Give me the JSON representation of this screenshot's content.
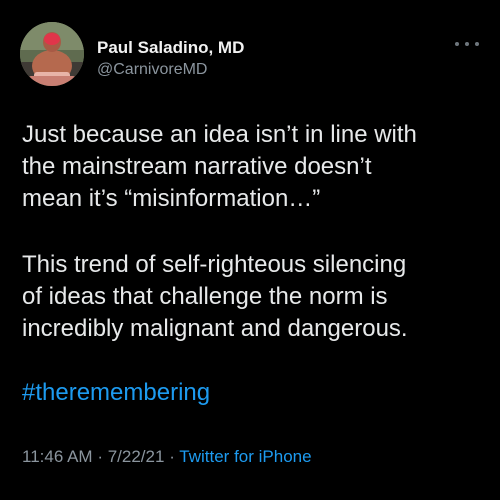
{
  "tweet": {
    "author_name": "Paul Saladino, MD",
    "author_handle": "@CarnivoreMD",
    "paragraph_1": "Just because an idea isn’t in line with\nthe mainstream narrative doesn’t\nmean it’s “misinformation…”",
    "paragraph_2": "This trend of self-righteous silencing\nof ideas that challenge the norm is\nincredibly malignant and dangerous.",
    "hashtag": "#theremembering",
    "time": "11:46 AM",
    "date": "7/22/21",
    "separator": "·",
    "source": "Twitter for iPhone"
  },
  "icons": {
    "more": "more-options-icon",
    "avatar": "profile-avatar"
  },
  "colors": {
    "background": "#000000",
    "text": "#e7e9ea",
    "secondary_text": "#8b959e",
    "link": "#1d9bf0"
  }
}
